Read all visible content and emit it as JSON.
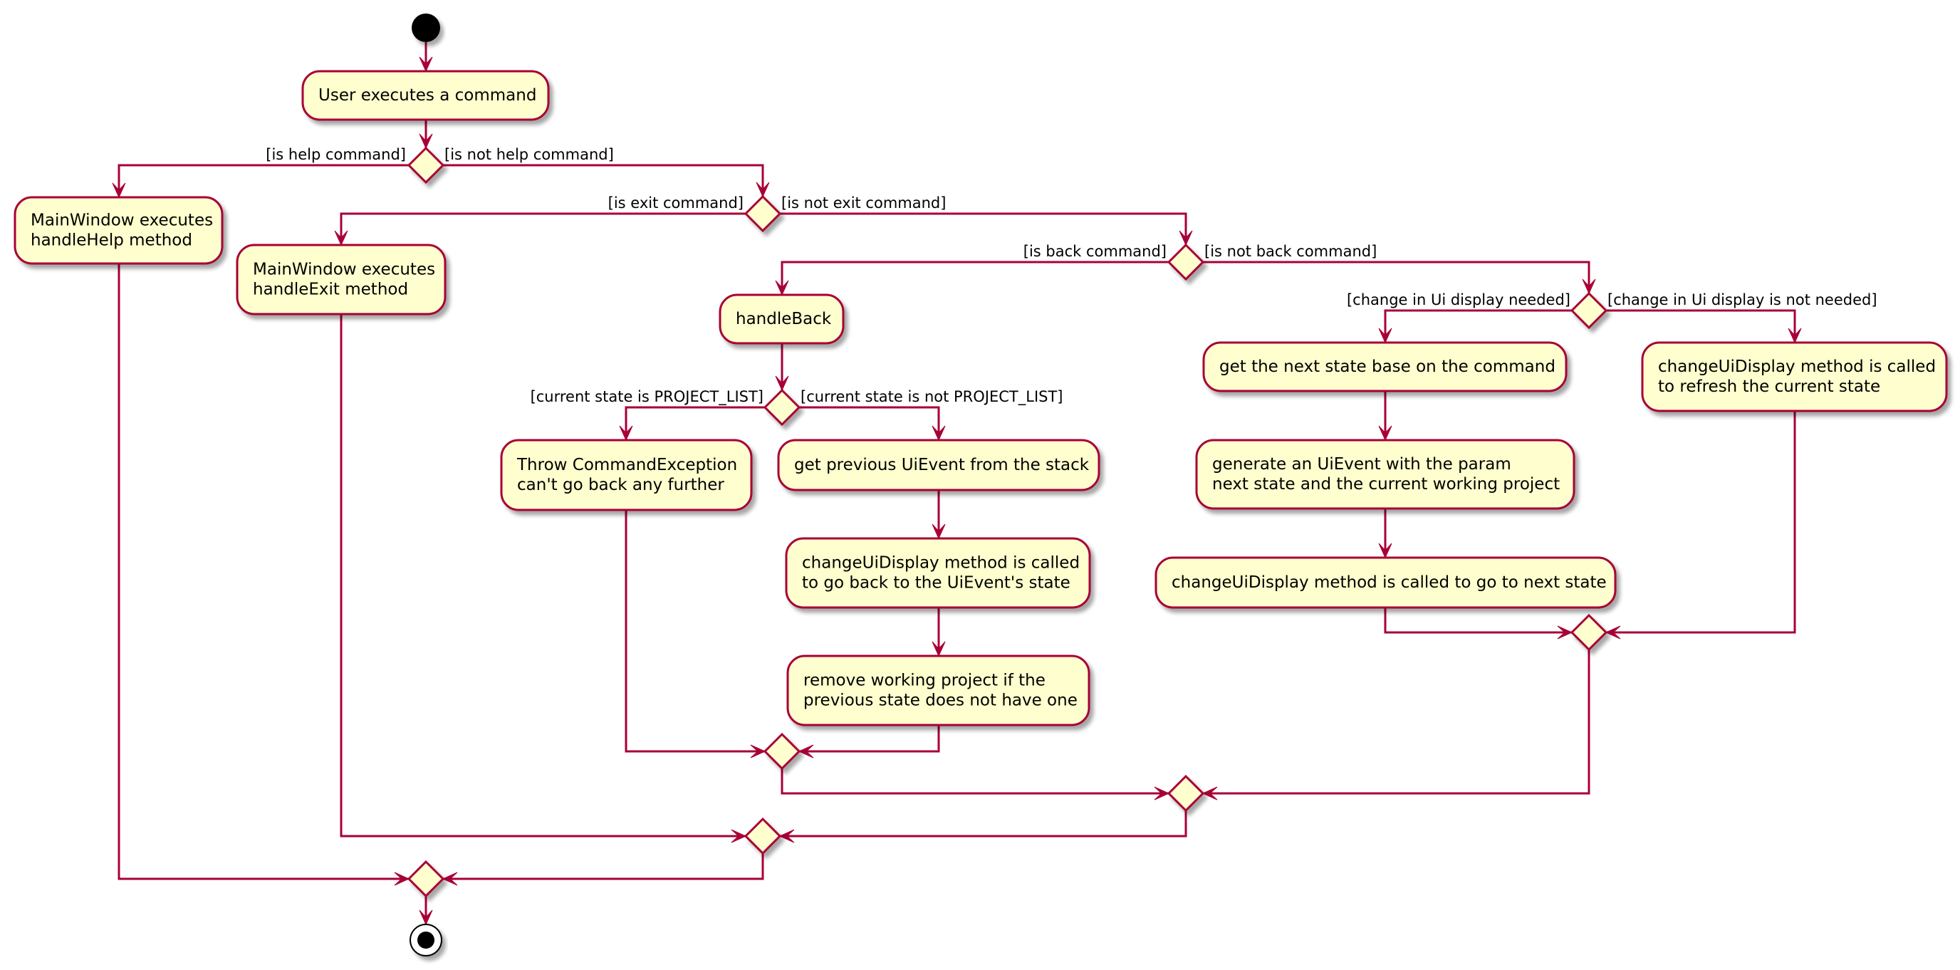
{
  "diagram": {
    "type": "UML activity diagram",
    "colors": {
      "stroke": "#A80036",
      "fill": "#FEFECE",
      "text": "#000000",
      "background": "#FFFFFF"
    },
    "start": {
      "label": "start"
    },
    "end": {
      "label": "end"
    },
    "activities": {
      "user_executes": [
        "User executes a command"
      ],
      "handle_help": [
        "MainWindow executes",
        "handleHelp method"
      ],
      "handle_exit": [
        "MainWindow executes",
        "handleExit method"
      ],
      "handle_back": [
        "handleBack"
      ],
      "throw_exception": [
        "Throw CommandException",
        "can't go back any further"
      ],
      "get_previous": [
        "get previous UiEvent from the stack"
      ],
      "change_back": [
        "changeUiDisplay method is called",
        "to go back to the UiEvent's state"
      ],
      "remove_project": [
        "remove working project if the",
        "previous state does not have one"
      ],
      "get_next_state": [
        "get the next state base on the command"
      ],
      "generate_event": [
        "generate an UiEvent with the param",
        "next state and the current working project"
      ],
      "change_next": [
        "changeUiDisplay method is called to go to next state"
      ],
      "change_refresh": [
        "changeUiDisplay method is called",
        "to refresh the current state"
      ]
    },
    "guards": {
      "is_help": "[is help command]",
      "is_not_help": "[is not help command]",
      "is_exit": "[is exit command]",
      "is_not_exit": "[is not exit command]",
      "is_back": "[is back command]",
      "is_not_back": "[is not back command]",
      "is_project_list": "[current state is PROJECT_LIST]",
      "is_not_project_list": "[current state is not PROJECT_LIST]",
      "ui_change_needed": "[change in Ui display needed]",
      "ui_change_not_needed": "[change in Ui display is not needed]"
    }
  }
}
